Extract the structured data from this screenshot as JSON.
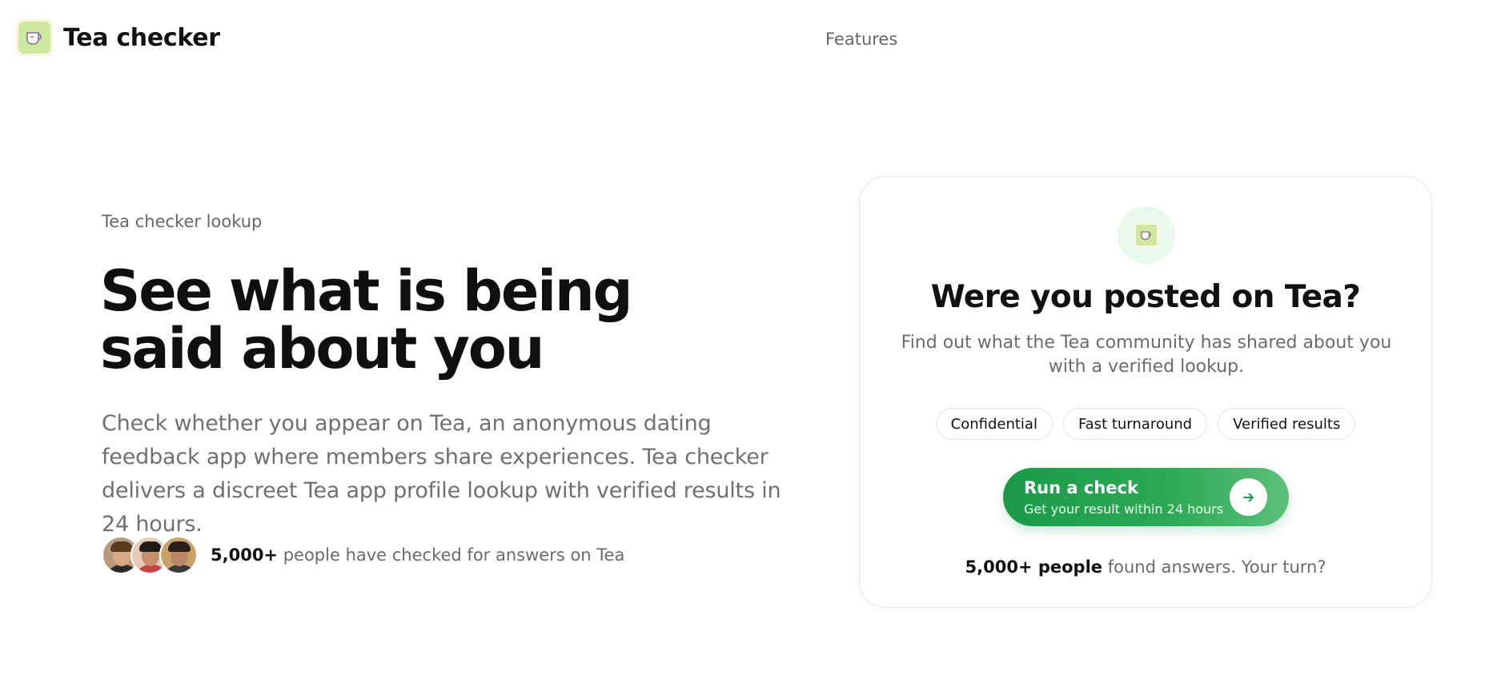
{
  "header": {
    "brand": "Tea checker",
    "logo_icon": "teacup-icon",
    "nav": [
      {
        "label": "Features"
      }
    ]
  },
  "hero": {
    "eyebrow": "Tea checker lookup",
    "title_line1": "See what is being",
    "title_line2_prefix": "said ",
    "title_line2_highlight": "about you",
    "description": "Check whether you appear on Tea, an anonymous dating feedback app where members share experiences. Tea checker delivers a discreet Tea app profile lookup with verified results in 24 hours.",
    "social_count": "5,000+",
    "social_text": " people have checked for answers on Tea"
  },
  "card": {
    "icon": "teacup-icon",
    "title": "Were you posted on Tea?",
    "subtitle": "Find out what the Tea community has shared about you with a verified lookup.",
    "chips": [
      {
        "label": "Confidential"
      },
      {
        "label": "Fast turnaround"
      },
      {
        "label": "Verified results"
      }
    ],
    "cta": {
      "label": "Run a check",
      "sublabel": "Get your result within 24 hours",
      "icon": "arrow-right-icon"
    },
    "footer_bold": "5,000+ people",
    "footer_text": " found answers. Your turn?"
  },
  "colors": {
    "accent_green": "#1f9d4d",
    "logo_green": "#cde9a0",
    "highlight": "#d7f0e1"
  }
}
